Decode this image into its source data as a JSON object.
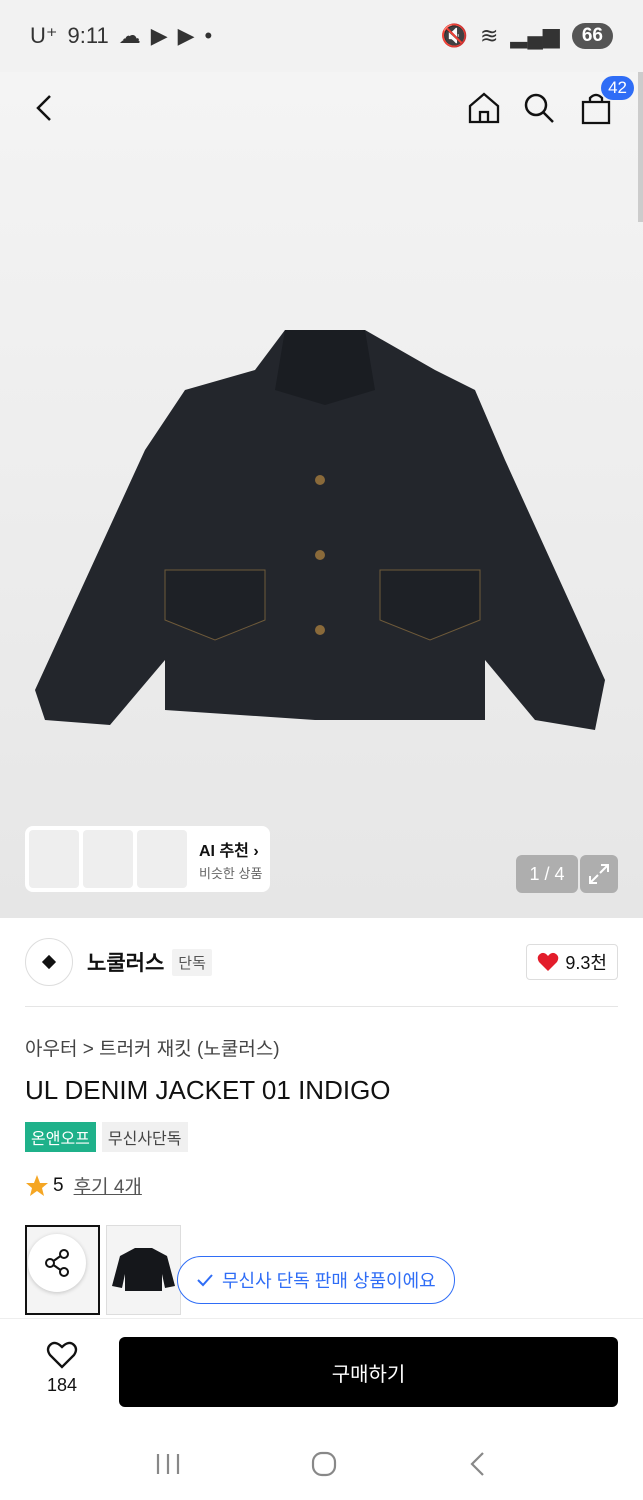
{
  "status_bar": {
    "carrier": "U⁺",
    "time": "9:11",
    "battery": "66"
  },
  "nav": {
    "cart_count": "42"
  },
  "gallery": {
    "ai_title": "AI 추천",
    "ai_subtitle": "비슷한 상품",
    "pager": "1 / 4"
  },
  "brand": {
    "name": "노쿨러스",
    "tag": "단독",
    "likes": "9.3천"
  },
  "product": {
    "breadcrumb": "아우터 > 트러커 재킷 (노쿨러스)",
    "title": "UL DENIM JACKET 01 INDIGO",
    "badge_1": "온앤오프",
    "badge_2": "무신사단독",
    "rating": "5",
    "reviews": "후기 4개"
  },
  "exclusive_pill": "무신사 단독 판매 상품이에요",
  "bottom": {
    "wish_count": "184",
    "buy_label": "구매하기"
  },
  "colors": {
    "accent_blue": "#2f6df6",
    "green_badge": "#1fb18a",
    "heart_red": "#e31d2b"
  }
}
